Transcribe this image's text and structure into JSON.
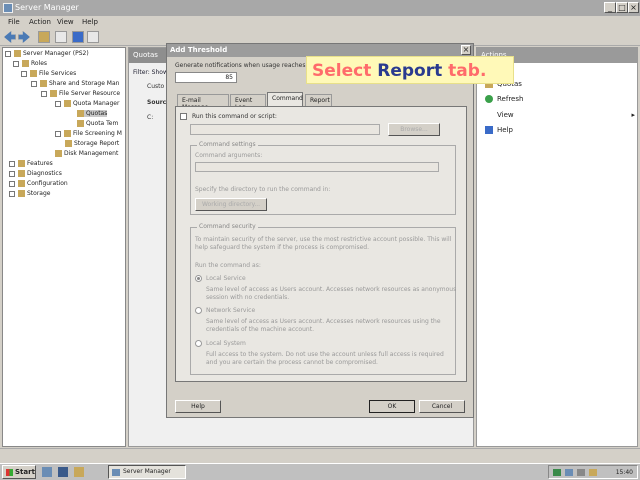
{
  "window": {
    "title": "Server Manager",
    "min": "_",
    "max": "□",
    "close": "×"
  },
  "menu": {
    "file": "File",
    "action": "Action",
    "view": "View",
    "help": "Help"
  },
  "tree": {
    "items": [
      "Server Manager (PS2)",
      "Roles",
      "File Services",
      "Share and Storage Man",
      "File Server Resource",
      "Quota Manager",
      "Quotas",
      "Quota Tem",
      "File Screening M",
      "Storage Report",
      "Disk Management",
      "Features",
      "Diagnostics",
      "Configuration",
      "Storage"
    ]
  },
  "center": {
    "header": "Quotas",
    "filter": "Filter: Show",
    "col1": "Custo",
    "col2": "Sourc",
    "row1": "C:"
  },
  "actions": {
    "header": "Actions",
    "items": [
      "Quotas",
      "Refresh",
      "View",
      "Help"
    ]
  },
  "dialog": {
    "title": "Add Threshold",
    "close": "×",
    "usage_label": "Generate notifications when usage reaches (%):",
    "usage_value": "85",
    "tabs": [
      "E-mail Message",
      "Event Log",
      "Command",
      "Report"
    ],
    "active_tab": "Command",
    "run_command_label": "Run this command or script:",
    "browse": "Browse...",
    "cmd_settings_title": "Command settings",
    "cmd_args_label": "Command arguments:",
    "workdir_label": "Specify the directory to run the command in:",
    "workdir_btn": "Working directory...",
    "security_title": "Command security",
    "security_text_1": "To maintain security of the server, use the most restrictive account possible. This will",
    "security_text_2": "help safeguard the system if the process is compromised.",
    "run_as_label": "Run the command as:",
    "opt_local_service": "Local Service",
    "opt_local_service_desc_1": "Same level of access as Users account. Accesses network resources as anonymous",
    "opt_local_service_desc_2": "session with no credentials.",
    "opt_network_service": "Network Service",
    "opt_network_service_desc_1": "Same level of access as Users account. Accesses network resources using the",
    "opt_network_service_desc_2": "credentials of the machine account.",
    "opt_local_system": "Local System",
    "opt_local_system_desc_1": "Full access to the system. Do not use the account unless full access is required",
    "opt_local_system_desc_2": "and you are certain the process cannot be compromised.",
    "help": "Help",
    "ok": "OK",
    "cancel": "Cancel"
  },
  "callout": {
    "part1": "Select ",
    "part2": "Report",
    "part3": " tab",
    "part4": "."
  },
  "taskbar": {
    "start": "Start",
    "app": "Server Manager",
    "clock": "15:40"
  }
}
